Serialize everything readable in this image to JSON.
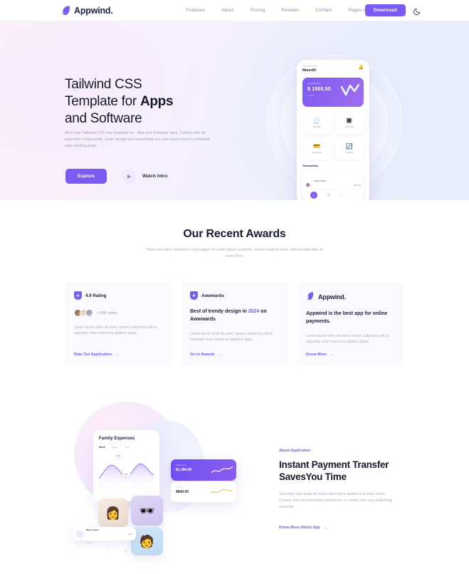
{
  "navbar": {
    "brand": "Appwind.",
    "brand_icon": "leaf-logo-icon",
    "links": [
      {
        "label": "Features"
      },
      {
        "label": "About"
      },
      {
        "label": "Pricing"
      },
      {
        "label": "Reviews"
      },
      {
        "label": "Contact"
      },
      {
        "label": "Pages",
        "caret": "▾"
      }
    ],
    "download_label": "Download",
    "theme_toggle_icon": "moon-icon"
  },
  "hero": {
    "title_line1": "Tailwind CSS",
    "title_line2_a": "Template for ",
    "title_line2_b": "Apps",
    "title_line3": "and Software",
    "subtitle": "All in one Tailwind CSS site template for - App and Software sites. Comes with all essential components, clean design and everything you can expect from a complete saas landing page.",
    "primary_cta": "Explore",
    "secondary_cta": "Watch Intro",
    "play_icon": "play-icon"
  },
  "phone": {
    "greeting": "Welcome back",
    "user": "Maurdih",
    "bell_icon": "bell-icon",
    "card": {
      "label": "Total Balance",
      "amount": "$ 1500,90",
      "sub": "+ 2.5%"
    },
    "tiles": [
      {
        "label": "Pay Bill",
        "icon": "receipt-icon",
        "glyph": "🧾"
      },
      {
        "label": "QR Scan",
        "icon": "qr-icon",
        "glyph": "🔳"
      },
      {
        "label": "My Cards",
        "icon": "card-icon",
        "glyph": "💳"
      },
      {
        "label": "Transfer",
        "icon": "transfer-icon",
        "glyph": "🔄"
      }
    ],
    "transactions_title": "Transactions",
    "transaction": {
      "name": "Online Store",
      "sub": "Shopping",
      "amount": "-$47.00"
    },
    "nav_icons": [
      "home-icon",
      "chart-icon",
      "wallet-icon",
      "bell-icon"
    ]
  },
  "awards": {
    "title": "Our Recent Awards",
    "subtitle": "There are many variations of passages of Lorem Ipsum available, but the majority have suffered alteration in some form.",
    "cards": [
      {
        "badge_icon": "shield-icon",
        "badge_text": "4.9 Rating",
        "avatars_more": "+195K raters",
        "body": "Lorem ipsum dolor sit amet, consec adipiscing elit at vulputate vitae massa eu dapibus ligula.",
        "link": "Rate Out Application",
        "link_arrow": "→"
      },
      {
        "badge_icon": "shield-icon",
        "badge_text": "Awwwards",
        "head_a": "Best of trendy design in ",
        "head_hl": "2024",
        "head_b": " on Awwwards",
        "body": "Lorem ipsum dolor sit amet, consec adipiscing elit at vulputate vitae massa eu dapibus ligula.",
        "link": "Go to Awards",
        "link_arrow": "→"
      },
      {
        "badge_icon": "leaf-logo-icon",
        "badge_text": "Appwind.",
        "head": "Appwind is the best app for online payments.",
        "body": "Lorem ipsum dolor sit amet, consec adipiscing elit at vulputate vitae massa eu dapibus ligula.",
        "link": "Know More",
        "link_arrow": "→"
      }
    ]
  },
  "about": {
    "eyebrow": "About Application",
    "title_line1": "Instant Payment Transfer",
    "title_line2": "SavesYou Time",
    "body": "Schedule your posts for times when your audience is most active. Choose from our best-time predictions, or create your own publishing schedule.",
    "link": "Know More About App",
    "link_arrow": "→",
    "mock": {
      "expenses_title": "Family Expenses",
      "tabs": [
        {
          "label": "Week",
          "active": true
        },
        {
          "label": "Month",
          "active": false
        },
        {
          "label": "Year",
          "active": false
        }
      ],
      "chart_pills": [
        "$90",
        "$47"
      ],
      "x_labels": [
        "S",
        "M",
        "T",
        "W",
        "T",
        "F",
        "S"
      ],
      "stat_purple": {
        "label": "Total Spent",
        "value": "$1,490.00"
      },
      "stat_white": {
        "label": "Income",
        "value": "$840.00"
      },
      "transaction_row": {
        "name": "Maria Castro",
        "sub": "Transfer",
        "amount": "$75"
      },
      "nav_icons": [
        "home-icon",
        "chart-icon",
        "card-icon",
        "user-icon"
      ]
    }
  }
}
